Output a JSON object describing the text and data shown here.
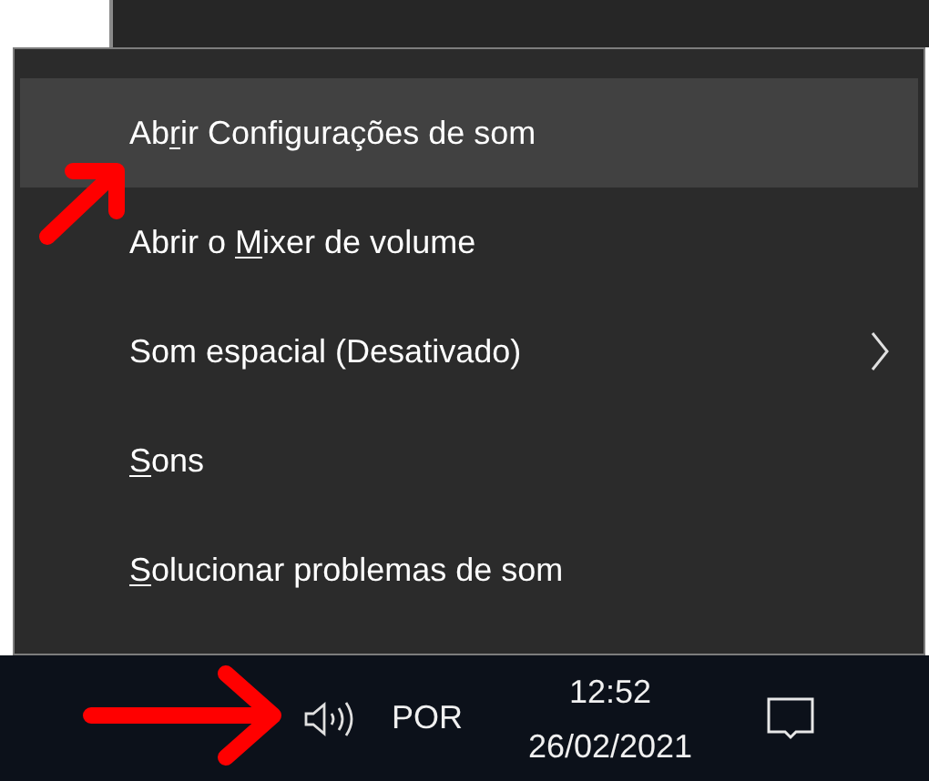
{
  "context_menu": {
    "items": [
      {
        "text_before": "Ab",
        "access_key": "r",
        "text_after": "ir Configurações de som",
        "selected": true,
        "has_submenu": false
      },
      {
        "text_before": "Abrir o ",
        "access_key": "M",
        "text_after": "ixer de volume",
        "selected": false,
        "has_submenu": false
      },
      {
        "text_before": "Som espacial (Desativado)",
        "selected": false,
        "has_submenu": true
      },
      {
        "access_key": "S",
        "text_after": "ons",
        "selected": false,
        "has_submenu": false
      },
      {
        "access_key": "S",
        "text_after": "olucionar problemas de som",
        "selected": false,
        "has_submenu": false
      }
    ]
  },
  "taskbar": {
    "language": "POR",
    "time": "12:52",
    "date": "26/02/2021"
  }
}
